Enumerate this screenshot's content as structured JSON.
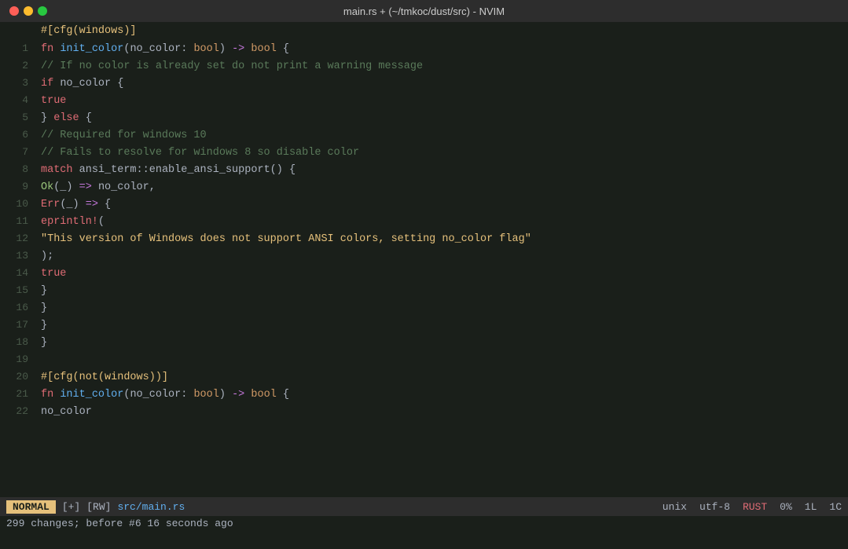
{
  "titleBar": {
    "title": "main.rs + (~/tmkoc/dust/src) - NVIM"
  },
  "statusBar": {
    "mode": "NORMAL",
    "modified": "[+]",
    "readwrite": "[RW]",
    "filename": "src/main.rs",
    "fileformat": "unix",
    "encoding": "utf-8",
    "filetype": "RUST",
    "percent": "0%",
    "line": "1L",
    "col": "1C"
  },
  "messageLine": {
    "text": "299 changes; before #6  16 seconds ago"
  },
  "lines": [
    {
      "num": "",
      "content": "#[cfg(windows)]",
      "type": "attr"
    },
    {
      "num": "1",
      "content": "fn init_color(no_color: bool) -> bool {",
      "type": "fn-decl"
    },
    {
      "num": "2",
      "content": "// If no color is already set do not print a warning message",
      "type": "comment"
    },
    {
      "num": "3",
      "content": "if no_color {",
      "type": "keyword"
    },
    {
      "num": "4",
      "content": "true",
      "type": "keyword-val"
    },
    {
      "num": "5",
      "content": "} else {",
      "type": "keyword"
    },
    {
      "num": "6",
      "content": "// Required for windows 10",
      "type": "comment"
    },
    {
      "num": "7",
      "content": "// Fails to resolve for windows 8 so disable color",
      "type": "comment"
    },
    {
      "num": "8",
      "content": "match ansi_term::enable_ansi_support() {",
      "type": "match"
    },
    {
      "num": "9",
      "content": "Ok(_) => no_color,",
      "type": "ok"
    },
    {
      "num": "10",
      "content": "Err(_) => {",
      "type": "err"
    },
    {
      "num": "11",
      "content": "eprintln!(",
      "type": "macro"
    },
    {
      "num": "12",
      "content": "\"This version of Windows does not support ANSI colors, setting no_color flag\"",
      "type": "string"
    },
    {
      "num": "13",
      "content": ");",
      "type": "normal"
    },
    {
      "num": "14",
      "content": "true",
      "type": "keyword-val"
    },
    {
      "num": "15",
      "content": "}",
      "type": "brace"
    },
    {
      "num": "16",
      "content": "}",
      "type": "brace"
    },
    {
      "num": "17",
      "content": "}",
      "type": "brace"
    },
    {
      "num": "18",
      "content": "}",
      "type": "brace"
    },
    {
      "num": "19",
      "content": "",
      "type": "empty"
    },
    {
      "num": "20",
      "content": "#[cfg(not(windows))]",
      "type": "attr"
    },
    {
      "num": "21",
      "content": "fn init_color(no_color: bool) -> bool {",
      "type": "fn-decl"
    },
    {
      "num": "22",
      "content": "no_color",
      "type": "normal"
    }
  ]
}
